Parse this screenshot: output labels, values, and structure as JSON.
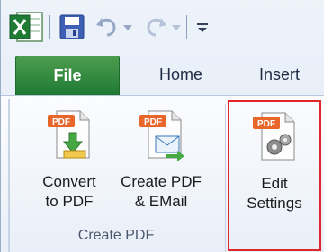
{
  "quick_access": {
    "icons": [
      "excel-icon",
      "save-icon",
      "undo-icon",
      "redo-icon",
      "customize-toolbar-icon"
    ]
  },
  "tabs": {
    "file": "File",
    "home": "Home",
    "insert": "Insert"
  },
  "ribbon": {
    "convert_label_1": "Convert",
    "convert_label_2": "to PDF",
    "email_label_1": "Create PDF",
    "email_label_2": "& EMail",
    "edit_label_1": "Edit",
    "edit_label_2": "Settings",
    "group_label": "Create PDF"
  },
  "colors": {
    "file_tab": "#2c8a3e",
    "highlight_border": "#e0262c",
    "pdf_badge": "#e8662a"
  }
}
